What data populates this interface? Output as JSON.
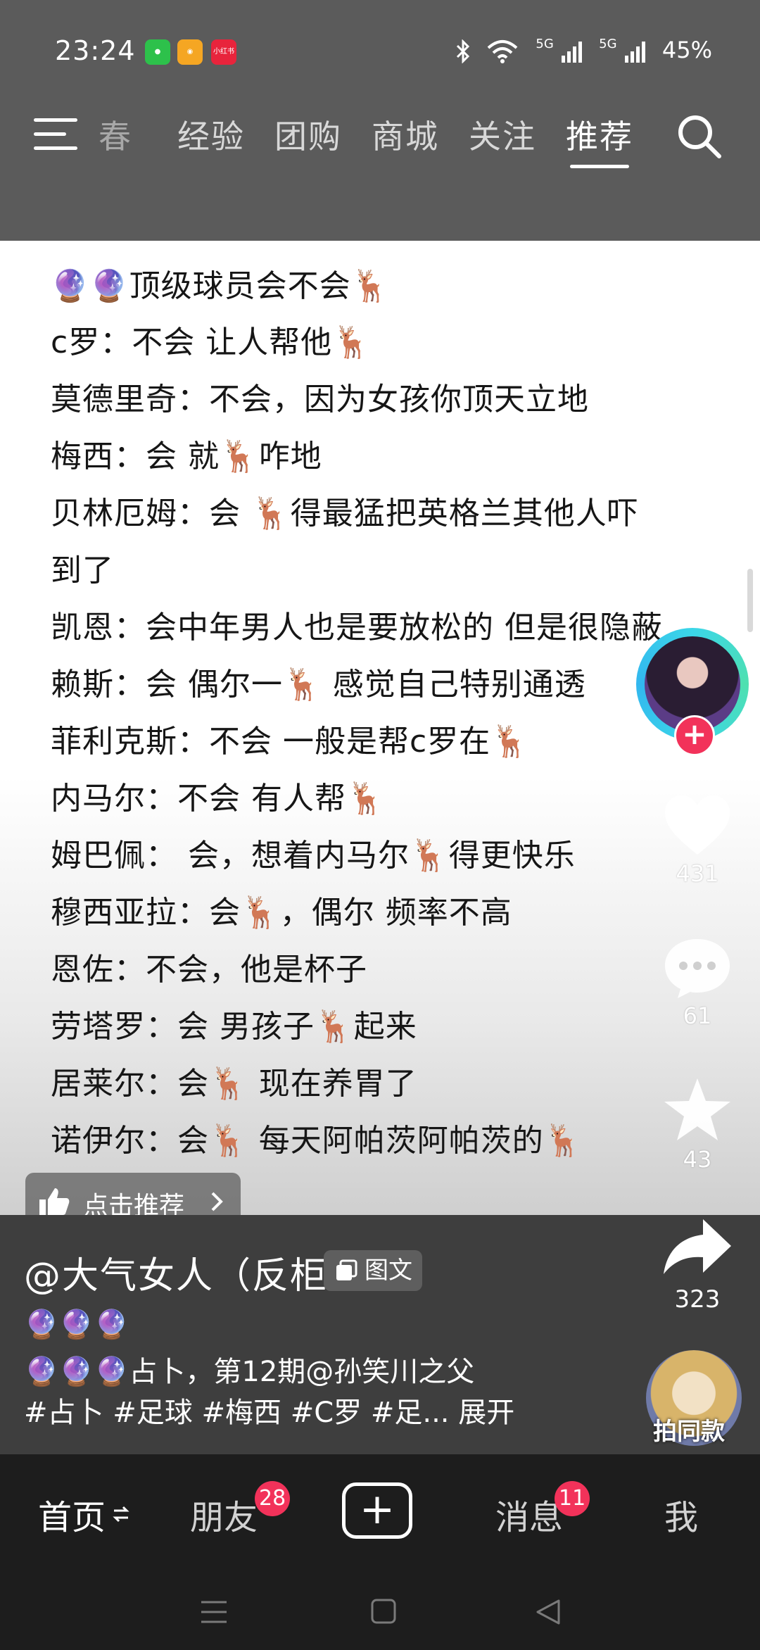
{
  "status_bar": {
    "time": "23:24",
    "apps": [
      "WeChat",
      "Weibo",
      "小红书"
    ],
    "app_colors": [
      "#2dc14b",
      "#f5a623",
      "#e8243c"
    ],
    "bluetooth": "bluetooth-icon",
    "wifi": "wifi-icon",
    "signal1": "5G",
    "signal2": "5G",
    "battery": "45%"
  },
  "top_nav": {
    "tabs": [
      {
        "label": "春"
      },
      {
        "label": "经验"
      },
      {
        "label": "团购"
      },
      {
        "label": "商城"
      },
      {
        "label": "关注"
      },
      {
        "label": "推荐"
      }
    ],
    "active": "推荐"
  },
  "post_lines": [
    "🔮🔮顶级球员会不会🦌",
    "c罗：不会 让人帮他🦌",
    "莫德里奇：不会，因为女孩你顶天立地",
    "梅西：会 就🦌咋地",
    "贝林厄姆：会 🦌得最猛把英格兰其他人吓",
    "到了",
    "凯恩：会中年男人也是要放松的 但是很隐蔽",
    "赖斯：会 偶尔一🦌 感觉自己特别通透",
    "菲利克斯：不会 一般是帮c罗在🦌",
    "内马尔：不会 有人帮🦌",
    "姆巴佩： 会，想着内马尔🦌得更快乐",
    "穆西亚拉：会🦌，偶尔 频率不高",
    "恩佐：不会，他是杯子",
    "劳塔罗：会 男孩子🦌起来",
    "居莱尔：会🦌 现在养胃了",
    "诺伊尔：会🦌 每天阿帕茨阿帕茨的🦌"
  ],
  "side_actions": {
    "like_count": "431",
    "comment_count": "61",
    "favorite_count": "43",
    "share_count": "323"
  },
  "recommend_chip": "点击推荐",
  "post_info": {
    "author": "@大气女人（反柜",
    "type_tag": "图文",
    "desc_line1": "🔮🔮🔮",
    "desc_line2": "🔮🔮🔮占卜，第12期@孙笑川之父",
    "desc_line3": "#占卜 #足球 #梅西 #C罗 #足... 展开",
    "same_style": "拍同款"
  },
  "tab_bar": {
    "home": "首页",
    "friends": "朋友",
    "friends_badge": "28",
    "messages": "消息",
    "messages_badge": "11",
    "me": "我"
  },
  "accent_color": "#f2325a"
}
